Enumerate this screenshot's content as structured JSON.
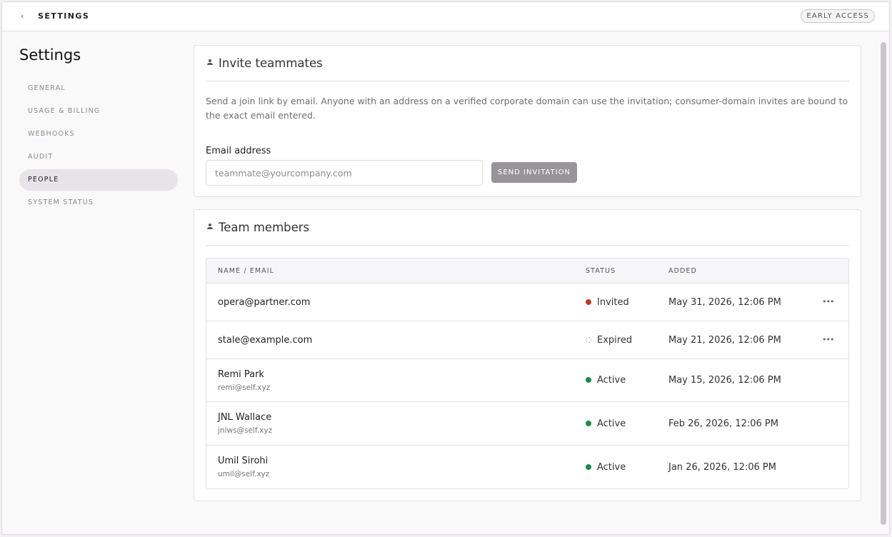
{
  "topbar": {
    "back_icon": "chevron-left-icon",
    "title": "SETTINGS",
    "badge": "EARLY ACCESS"
  },
  "sidebar": {
    "title": "Settings",
    "items": [
      {
        "label": "GENERAL",
        "active": false
      },
      {
        "label": "USAGE & BILLING",
        "active": false
      },
      {
        "label": "WEBHOOKS",
        "active": false
      },
      {
        "label": "AUDIT",
        "active": false
      },
      {
        "label": "PEOPLE",
        "active": true
      },
      {
        "label": "SYSTEM STATUS",
        "active": false
      }
    ]
  },
  "invite": {
    "icon": "person-icon",
    "title": "Invite teammates",
    "description": "Send a join link by email. Anyone with an address on a verified corporate domain can use the invitation; consumer-domain invites are bound to the exact email entered.",
    "email_label": "Email address",
    "email_value": "",
    "email_placeholder": "teammate@yourcompany.com",
    "send_label": "SEND INVITATION"
  },
  "team": {
    "icon": "person-icon",
    "title": "Team members",
    "columns": [
      "NAME / EMAIL",
      "STATUS",
      "ADDED"
    ],
    "status_colors": {
      "Invited": "#b5401a",
      "Active": "#1a8a4a",
      "Expired": "#b9b6bc"
    },
    "rows": [
      {
        "name": "opera@partner.com",
        "email": "",
        "status": "Invited",
        "added": "May 31, 2026, 12:06 PM",
        "menu": true
      },
      {
        "name": "stale@example.com",
        "email": "",
        "status": "Expired",
        "added": "May 21, 2026, 12:06 PM",
        "menu": true
      },
      {
        "name": "Remi Park",
        "email": "remi@self.xyz",
        "status": "Active",
        "added": "May 15, 2026, 12:06 PM",
        "menu": false
      },
      {
        "name": "JNL Wallace",
        "email": "jnlws@self.xyz",
        "status": "Active",
        "added": "Feb 26, 2026, 12:06 PM",
        "menu": false
      },
      {
        "name": "Umil Sirohi",
        "email": "umil@self.xyz",
        "status": "Active",
        "added": "Jan 26, 2026, 12:06 PM",
        "menu": false
      }
    ]
  }
}
